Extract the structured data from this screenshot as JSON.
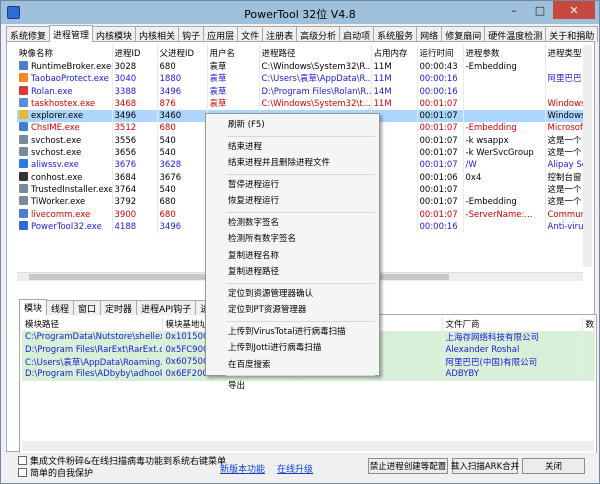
{
  "window": {
    "title": "PowerTool 32位 V4.8"
  },
  "titlebar_buttons": {
    "min": "–",
    "max": "□",
    "close": "✕"
  },
  "tabs": [
    "系统修复",
    "进程管理",
    "内核模块",
    "内核相关",
    "钩子",
    "应用层",
    "文件",
    "注册表",
    "高级分析",
    "启动项",
    "系统服务",
    "网络",
    "修复扇间",
    "硬件温度检测",
    "关于和捐助"
  ],
  "active_tab": 1,
  "process_columns": [
    "映像名称",
    "进程ID",
    "父进程ID",
    "用户名",
    "进程路径",
    "占用内存",
    "运行时间",
    "进程参数",
    "进程类型"
  ],
  "processes": [
    {
      "name": "RuntimeBroker.exe",
      "pid": "3028",
      "ppid": "680",
      "user": "袁草",
      "path": "C:\\Windows\\System32\\R...",
      "mem": "11M",
      "time": "00:00:43",
      "args": "-Embedding",
      "type": "",
      "style": "w",
      "icon": "#4a7fd0"
    },
    {
      "name": "TaobaoProtect.exe",
      "pid": "3040",
      "ppid": "1880",
      "user": "袁草",
      "path": "C:\\Users\\袁草\\AppData\\R...",
      "mem": "11M",
      "time": "00:00:16",
      "args": "",
      "type": "阿里巴巴",
      "style": "blue",
      "icon": "#f08a24"
    },
    {
      "name": "Rolan.exe",
      "pid": "3388",
      "ppid": "3496",
      "user": "袁草",
      "path": "D:\\Program Files\\Rolan\\R...",
      "mem": "14M",
      "time": "00:00:16",
      "args": "",
      "type": "",
      "style": "blue",
      "icon": "#d43b3b"
    },
    {
      "name": "taskhostex.exe",
      "pid": "3468",
      "ppid": "876",
      "user": "袁草",
      "path": "C:\\Windows\\System32\\t...",
      "mem": "11M",
      "time": "00:01:07",
      "args": "",
      "type": "Windows",
      "style": "red",
      "icon": "#5a8fd6"
    },
    {
      "name": "explorer.exe",
      "pid": "3496",
      "ppid": "3460",
      "user": "",
      "path": "",
      "mem": "",
      "time": "00:01:07",
      "args": "",
      "type": "Windows",
      "style": "sel",
      "icon": "#e8b73a"
    },
    {
      "name": "ChsIME.exe",
      "pid": "3512",
      "ppid": "680",
      "user": "",
      "path": "",
      "mem": "",
      "time": "00:01:07",
      "args": "-Embedding",
      "type": "Microsoft",
      "style": "red",
      "icon": "#3e7ed4"
    },
    {
      "name": "svchost.exe",
      "pid": "3556",
      "ppid": "540",
      "user": "",
      "path": "",
      "mem": "",
      "time": "00:01:07",
      "args": "-k wsappx",
      "type": "这是一个",
      "style": "w",
      "icon": "#7a8a9a"
    },
    {
      "name": "svchost.exe",
      "pid": "3656",
      "ppid": "540",
      "user": "",
      "path": "",
      "mem": "",
      "time": "00:01:07",
      "args": "-k WerSvcGroup",
      "type": "这是一个",
      "style": "w",
      "icon": "#7a8a9a"
    },
    {
      "name": "aliwssv.exe",
      "pid": "3676",
      "ppid": "3628",
      "user": "",
      "path": "",
      "mem": "",
      "time": "00:01:07",
      "args": "/W",
      "type": "Alipay Se",
      "style": "blue",
      "icon": "#2a7ae0"
    },
    {
      "name": "conhost.exe",
      "pid": "3684",
      "ppid": "3676",
      "user": "",
      "path": "",
      "mem": "",
      "time": "00:01:06",
      "args": "0x4",
      "type": "控制台窗",
      "style": "w",
      "icon": "#333333"
    },
    {
      "name": "TrustedInstaller.exe",
      "pid": "3764",
      "ppid": "540",
      "user": "",
      "path": "",
      "mem": "",
      "time": "00:01:07",
      "args": "",
      "type": "这是一个",
      "style": "w",
      "icon": "#7a8a9a"
    },
    {
      "name": "TiWorker.exe",
      "pid": "3792",
      "ppid": "680",
      "user": "",
      "path": "",
      "mem": "",
      "time": "00:01:07",
      "args": "-Embedding",
      "type": "这是一个",
      "style": "w",
      "icon": "#7a8a9a"
    },
    {
      "name": "livecomm.exe",
      "pid": "3900",
      "ppid": "680",
      "user": "",
      "path": "",
      "mem": "",
      "time": "00:01:07",
      "args": "-ServerName:...",
      "type": "Commun",
      "style": "red",
      "icon": "#4a7fd0"
    },
    {
      "name": "PowerTool32.exe",
      "pid": "4188",
      "ppid": "3496",
      "user": "",
      "path": "",
      "mem": "",
      "time": "00:00:16",
      "args": "",
      "type": "Anti-virus",
      "style": "blue",
      "icon": "#2f6bd6"
    }
  ],
  "subtabs": [
    "模块",
    "线程",
    "窗口",
    "定时器",
    "进程API钩子",
    "进程"
  ],
  "active_subtab": 0,
  "module_columns": [
    "模块路径",
    "模块基地址",
    "",
    "",
    "文件厂商",
    "数字签名"
  ],
  "modules": [
    {
      "path": "C:\\ProgramData\\Nutstore\\shellex...",
      "base": "0x1015000",
      "ver": "3, 4, 0",
      "vendor": "上海存网络科技有限公司",
      "style": "g"
    },
    {
      "path": "D:\\Program Files\\RarExt\\RarExt.dll",
      "base": "0x5FC90000",
      "ver": "扩展 5.21.0",
      "vendor": "Alexander Roshal",
      "style": "g"
    },
    {
      "path": "C:\\Users\\袁草\\AppData\\Roaming...",
      "base": "0x6075000",
      "ver": "ctSE 5.24.1.5",
      "vendor": "阿里巴巴(中国)有限公司",
      "style": "g"
    },
    {
      "path": "D:\\Program Files\\ADbyby\\adhook...",
      "base": "0x6EF2000",
      "ver": "4.3.2",
      "vendor": "ADBYBY",
      "style": "g"
    }
  ],
  "context_menu": [
    "刷新 (F5)",
    "-",
    "结束进程",
    "结束进程并且删除进程文件",
    "-",
    "暂停进程运行",
    "恢复进程运行",
    "-",
    "检测数字签名",
    "检测所有数字签名",
    "复制进程名称",
    "复制进程路径",
    "-",
    "定位到资源管理器确认",
    "定位到PT资源管理器",
    "-",
    "上传到VirusTotal进行病毒扫描",
    "上传到Jotti进行病毒扫描",
    "在百度搜索",
    "-",
    "导出"
  ],
  "bottom": {
    "check1": "集成文件粉碎&在线扫描病毒功能到系统右键菜单",
    "check2": "简单的自我保护",
    "link_new": "新版本功能",
    "link_update": "在线升级",
    "btn_forbid": "禁止进程创建等配置",
    "btn_import": "载入扫描ARK合并",
    "btn_close": "关闭"
  }
}
